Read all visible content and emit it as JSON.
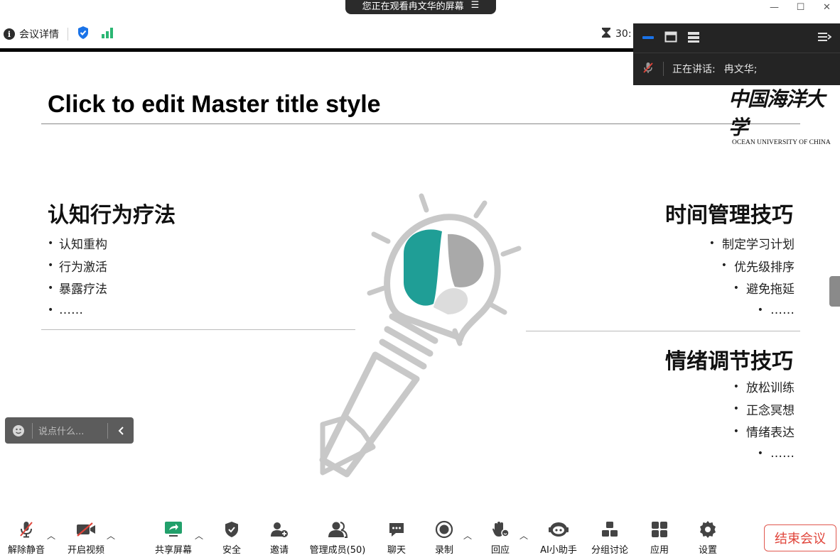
{
  "window": {
    "minimize_glyph": "—",
    "maximize_glyph": "☐",
    "close_glyph": "✕"
  },
  "share_banner": {
    "text": "您正在观看冉文华的屏幕",
    "menu_glyph": "☰"
  },
  "infobar": {
    "meeting_details_label": "会议详情",
    "timer_text": "30:"
  },
  "speaker_panel": {
    "speaking_label": "正在讲话:",
    "speaker_name": "冉文华;"
  },
  "slide": {
    "title": "Click to edit Master title style",
    "logo_cn": "中国海洋大学",
    "logo_en": "OCEAN UNIVERSITY OF CHINA",
    "left_section": {
      "heading": "认知行为疗法",
      "items": [
        "认知重构",
        "行为激活",
        "暴露疗法",
        "……"
      ]
    },
    "right_top_section": {
      "heading": "时间管理技巧",
      "items": [
        "制定学习计划",
        "优先级排序",
        "避免拖延",
        "……"
      ]
    },
    "right_bottom_section": {
      "heading": "情绪调节技巧",
      "items": [
        "放松训练",
        "正念冥想",
        "情绪表达",
        "……"
      ]
    },
    "bullet": "•"
  },
  "chat": {
    "placeholder": "说点什么..."
  },
  "toolbar": {
    "unmute": "解除静音",
    "start_video": "开启视频",
    "share_screen": "共享屏幕",
    "security": "安全",
    "invite": "邀请",
    "participants": "管理成员(50)",
    "chat": "聊天",
    "record": "录制",
    "reactions": "回应",
    "ai_assistant": "AI小助手",
    "breakout": "分组讨论",
    "apps": "应用",
    "settings": "设置",
    "end_meeting": "结束会议"
  },
  "colors": {
    "accent_blue": "#1a73e8",
    "signal_green": "#2bb673",
    "brain_teal": "#1f9e96",
    "end_red": "#e0443a",
    "share_green": "#22a06b"
  }
}
